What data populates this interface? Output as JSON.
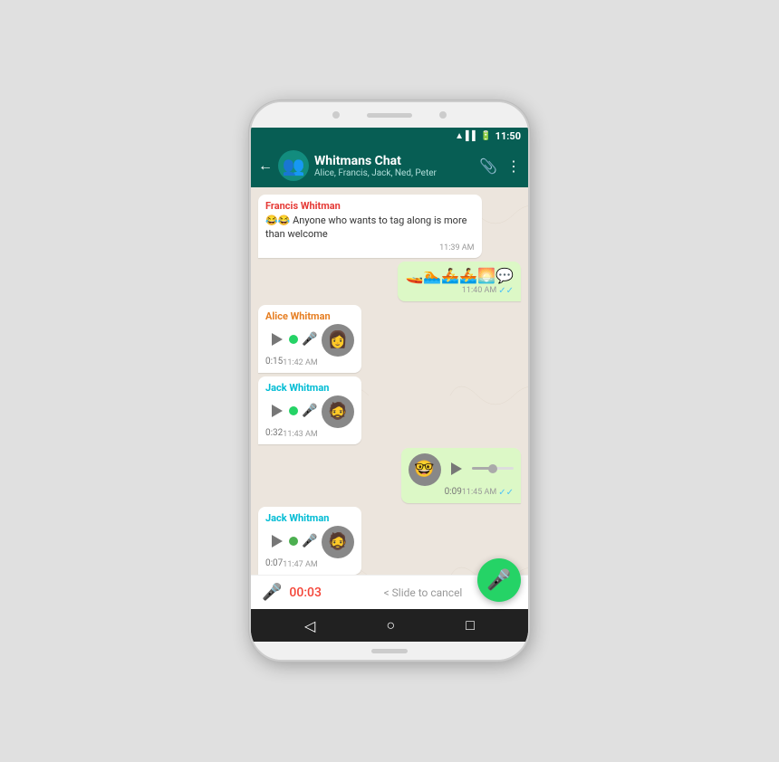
{
  "phone": {
    "status_bar": {
      "time": "11:50"
    },
    "header": {
      "title": "Whitmans Chat",
      "members": "Alice, Francis, Jack, Ned, Peter",
      "back_label": "←",
      "attach_icon": "📎",
      "more_icon": "⋮"
    },
    "messages": [
      {
        "id": "msg1",
        "type": "incoming",
        "sender": "Francis Whitman",
        "sender_color": "francis",
        "text": "😂😂 Anyone who wants to tag along is more than welcome",
        "time": "11:39 AM",
        "checks": ""
      },
      {
        "id": "msg2",
        "type": "outgoing",
        "text": "🚤🏊🚣🚣🌅💬",
        "time": "11:40 AM",
        "checks": "✓✓"
      },
      {
        "id": "msg3",
        "type": "voice_incoming",
        "sender": "Alice Whitman",
        "sender_color": "alice",
        "duration": "0:15",
        "time": "11:42 AM",
        "checks": "",
        "progress": 15,
        "avatar": "👩"
      },
      {
        "id": "msg4",
        "type": "voice_incoming",
        "sender": "Jack Whitman",
        "sender_color": "jack",
        "duration": "0:32",
        "time": "11:43 AM",
        "checks": "",
        "progress": 20,
        "avatar": "🧔"
      },
      {
        "id": "msg5",
        "type": "voice_outgoing",
        "duration": "0:09",
        "time": "11:45 AM",
        "checks": "✓✓",
        "progress": 50,
        "avatar": "👓"
      },
      {
        "id": "msg6",
        "type": "voice_incoming",
        "sender": "Jack Whitman",
        "sender_color": "jack",
        "duration": "0:07",
        "time": "11:47 AM",
        "checks": "",
        "progress": 10,
        "avatar": "🧔"
      }
    ],
    "recording": {
      "time": "00:03",
      "cancel_label": "< Slide to cancel"
    },
    "nav": {
      "back": "◁",
      "home": "○",
      "recent": "□"
    }
  }
}
